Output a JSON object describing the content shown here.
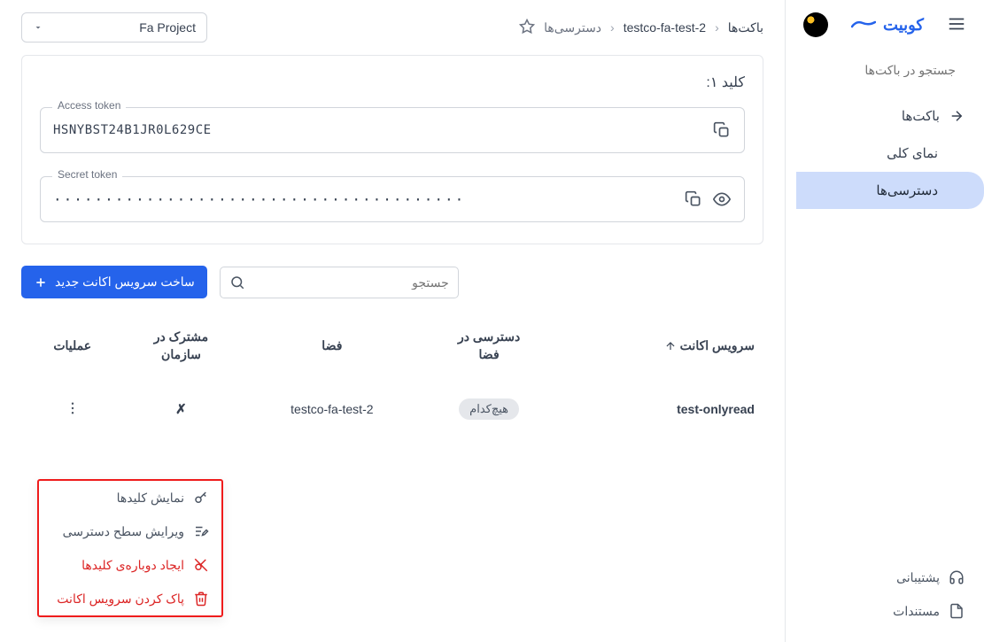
{
  "brand": "کوبیت",
  "sidebar": {
    "search_placeholder": "جستجو در باکت‌ها",
    "items": [
      {
        "label": "باکت‌ها"
      },
      {
        "label": "نمای کلی"
      },
      {
        "label": "دسترسی‌ها"
      }
    ],
    "footer": {
      "support": "پشتیبانی",
      "docs": "مستندات"
    }
  },
  "project_selector": "Fa Project",
  "breadcrumbs": {
    "root": "باکت‌ها",
    "bucket": "testco-fa-test-2",
    "page": "دسترسی‌ها"
  },
  "keys_card": {
    "title": "کلید ۱:",
    "access_label": "Access token",
    "access_value": "HSNYBST24B1JR0L629CE",
    "secret_label": "Secret token",
    "secret_value": "········································"
  },
  "toolbar": {
    "create_label": "ساخت سرویس اکانت جدید",
    "search_placeholder": "جستجو"
  },
  "table": {
    "headers": {
      "service_account": "سرویس اکانت",
      "space_access_l1": "دسترسی در",
      "space_access_l2": "فضا",
      "space": "فضا",
      "shared_l1": "مشترک در",
      "shared_l2": "سازمان",
      "actions": "عملیات"
    },
    "rows": [
      {
        "account": "test-onlyread",
        "access_badge": "هیچ‌کدام",
        "space": "testco-fa-test-2",
        "shared": "✗"
      }
    ]
  },
  "context_menu": {
    "show_keys": "نمایش کلیدها",
    "edit_access": "ویرایش سطح دسترسی",
    "regenerate": "ایجاد دوباره‌ی کلیدها",
    "delete": "پاک کردن سرویس اکانت"
  }
}
